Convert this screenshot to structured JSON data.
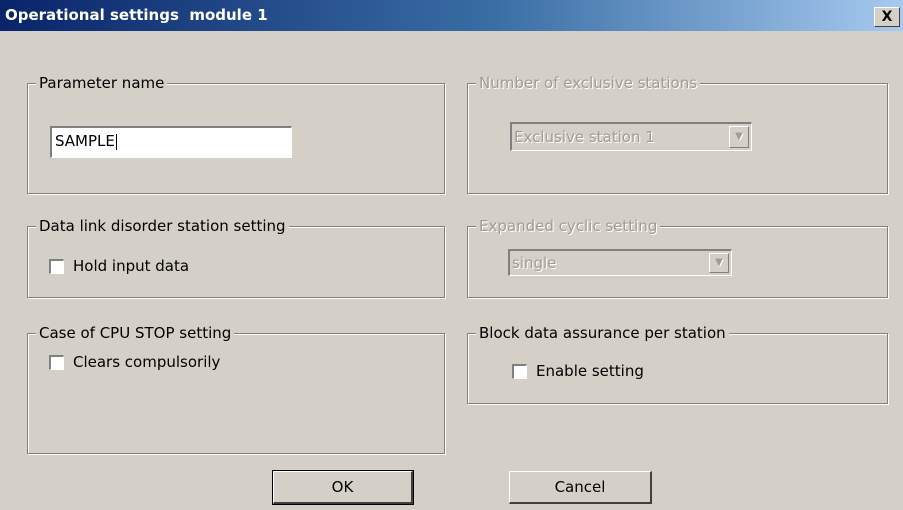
{
  "window": {
    "title": "Operational settings  module 1",
    "close_label": "X"
  },
  "parameter_name": {
    "label": "Parameter name",
    "value": "SAMPLE"
  },
  "exclusive_stations": {
    "label": "Number of exclusive stations",
    "selected": "Exclusive station 1",
    "enabled": false
  },
  "data_link": {
    "label": "Data link disorder station setting",
    "checkbox_label": "Hold input data",
    "checked": false
  },
  "expanded_cyclic": {
    "label": "Expanded cyclic setting",
    "selected": "single",
    "enabled": false
  },
  "cpu_stop": {
    "label": "Case of CPU STOP setting",
    "checkbox_label": "Clears compulsorily",
    "checked": false
  },
  "block_data": {
    "label": "Block data assurance per station",
    "checkbox_label": "Enable setting",
    "checked": false
  },
  "buttons": {
    "ok": "OK",
    "cancel": "Cancel"
  },
  "colors": {
    "dialog_bg": "#d4d0c8",
    "title_start": "#0a246a",
    "title_end": "#a6caf0",
    "disabled_text": "#a09c94"
  },
  "icons": {
    "dropdown": "chevron-down-icon",
    "close": "close-icon"
  }
}
